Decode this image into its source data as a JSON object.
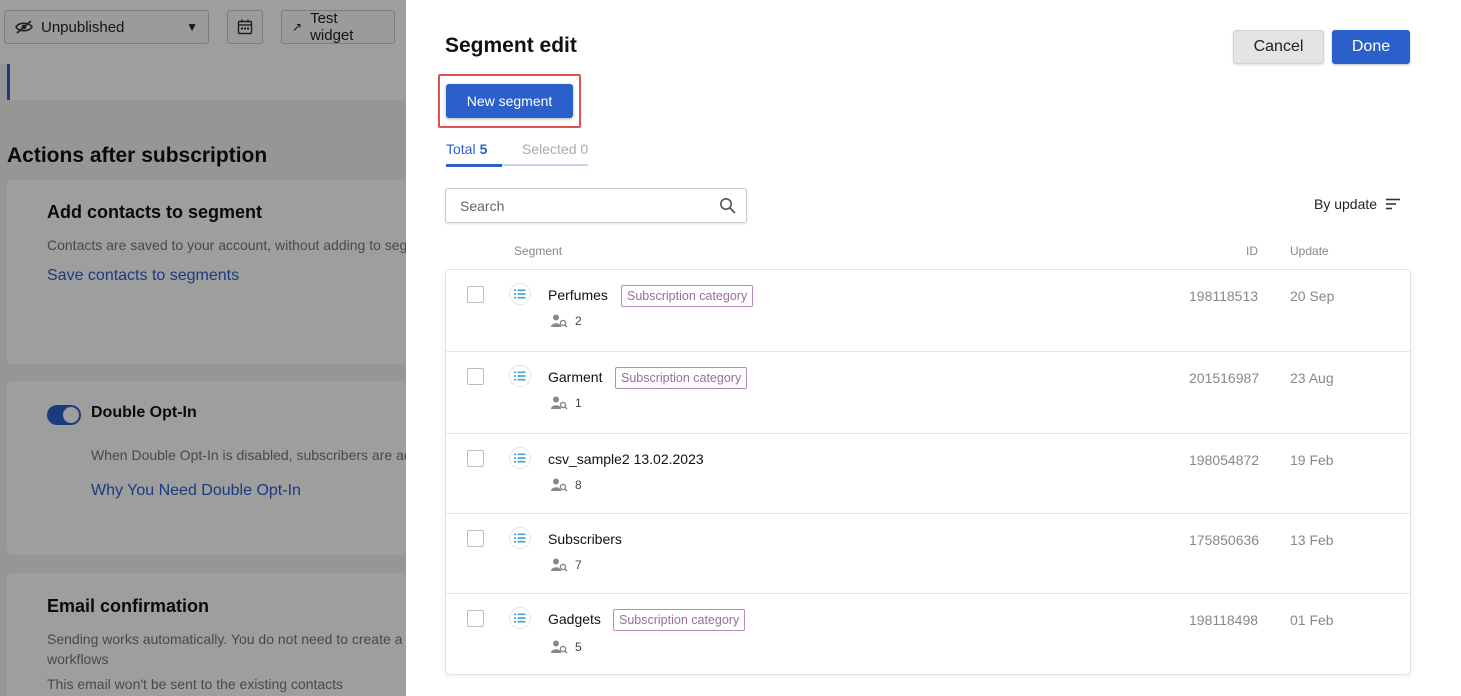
{
  "background": {
    "status_select": "Unpublished",
    "test_widget_label": "Test widget",
    "section_title": "Actions after subscription",
    "cards": [
      {
        "title": "Add contacts to segment",
        "text": "Contacts are saved to your account, without adding to seg",
        "link": "Save contacts to segments"
      },
      {
        "title": "Double Opt-In",
        "text": "When Double Opt-In is disabled, subscribers are ad",
        "link": "Why You Need Double Opt-In"
      },
      {
        "title": "Email confirmation",
        "text1": "Sending works automatically. You do not need to create a",
        "text2": "workflows",
        "text3": "This email won't be sent to the existing contacts"
      }
    ]
  },
  "panel": {
    "title": "Segment edit",
    "cancel_label": "Cancel",
    "done_label": "Done",
    "new_segment_label": "New segment",
    "tabs": {
      "total_label": "Total",
      "total_count": "5",
      "selected_label": "Selected 0"
    },
    "search_placeholder": "Search",
    "sort_label": "By update",
    "columns": {
      "segment": "Segment",
      "id": "ID",
      "update": "Update"
    },
    "rows": [
      {
        "name": "Perfumes",
        "badge": "Subscription category",
        "members": "2",
        "id": "198118513",
        "update": "20 Sep"
      },
      {
        "name": "Garment",
        "badge": "Subscription category",
        "members": "1",
        "id": "201516987",
        "update": "23 Aug"
      },
      {
        "name": "csv_sample2 13.02.2023",
        "badge": "",
        "members": "8",
        "id": "198054872",
        "update": "19 Feb"
      },
      {
        "name": "Subscribers",
        "badge": "",
        "members": "7",
        "id": "175850636",
        "update": "13 Feb"
      },
      {
        "name": "Gadgets",
        "badge": "Subscription category",
        "members": "5",
        "id": "198118498",
        "update": "01 Feb"
      }
    ]
  },
  "colors": {
    "accent": "#2b5fc9",
    "badge": "#9c6b9c",
    "highlight": "#e05252"
  }
}
